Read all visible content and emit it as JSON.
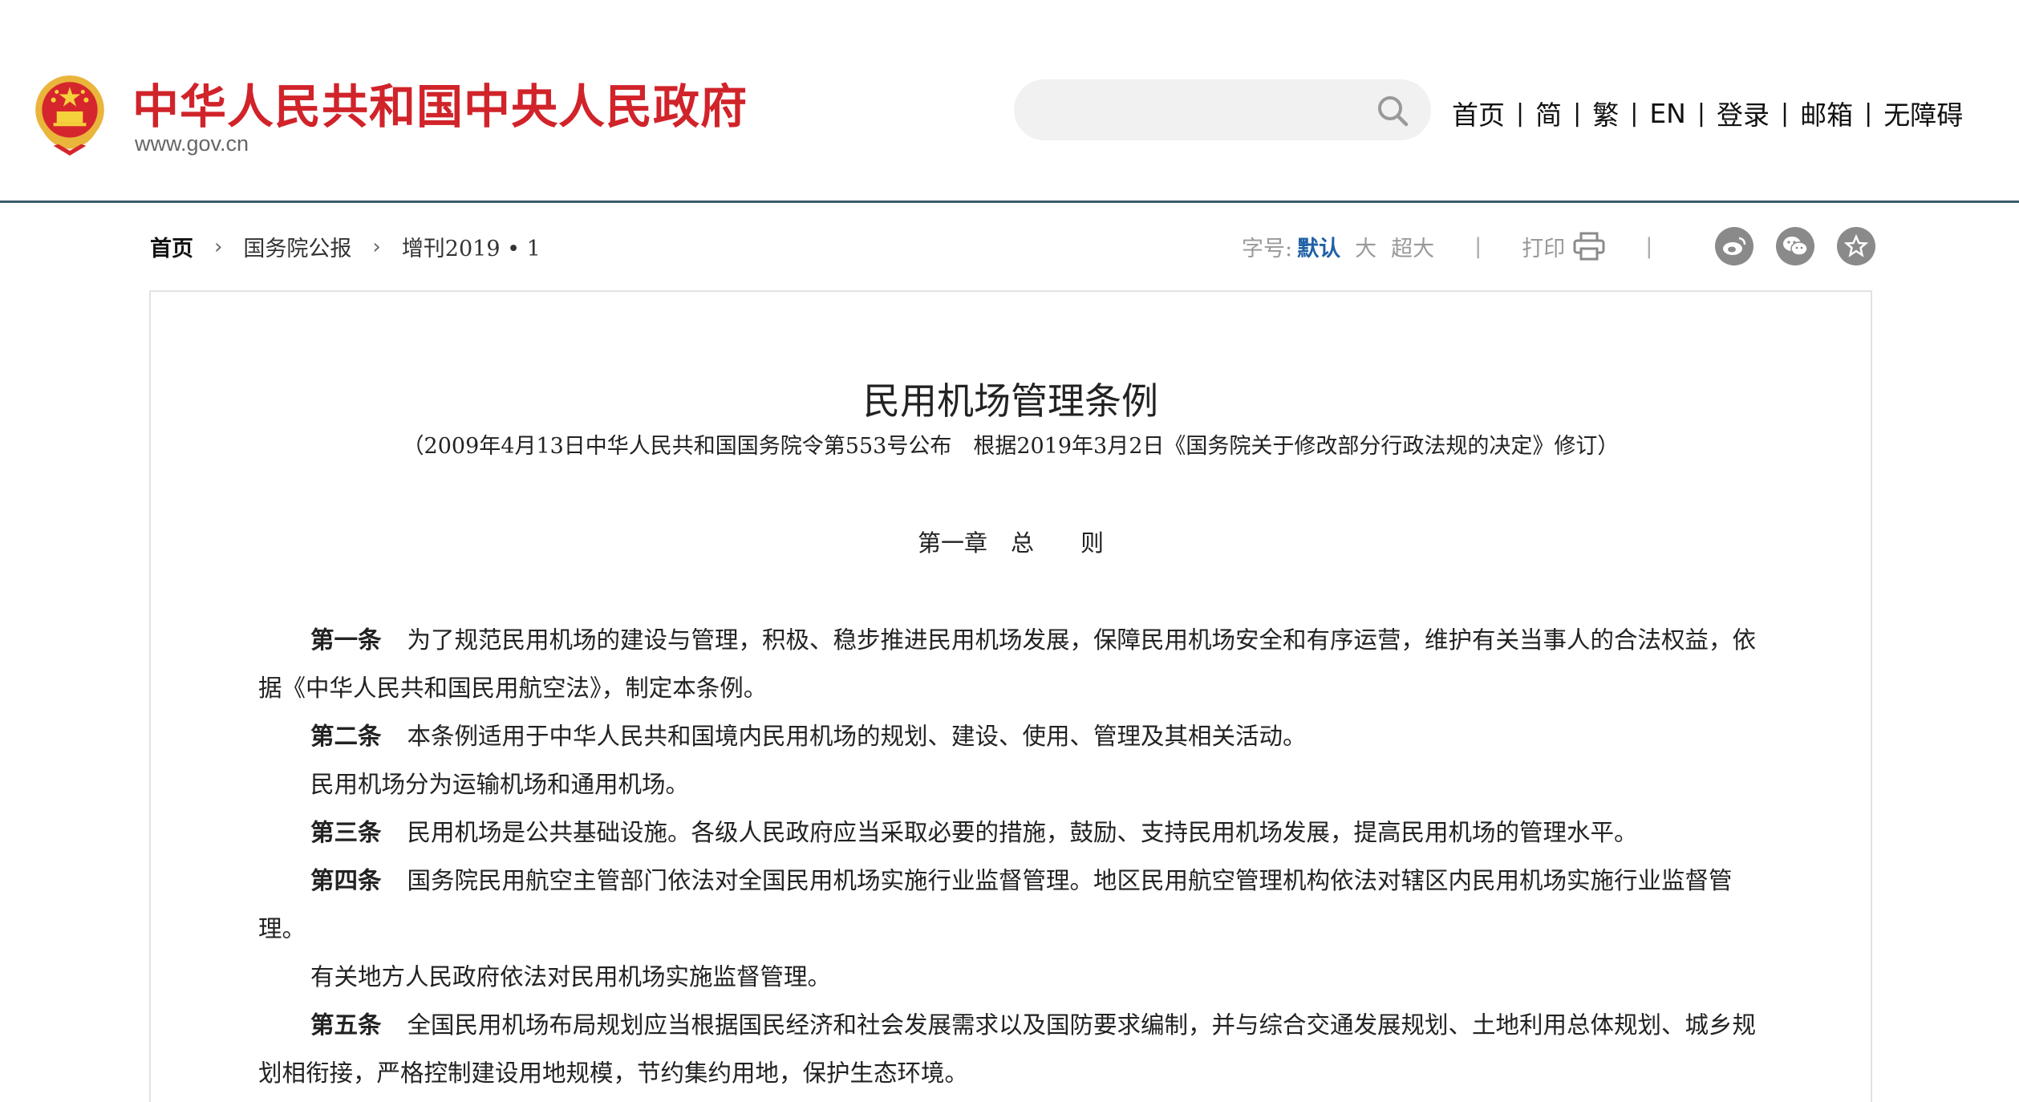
{
  "header": {
    "site_title": "中华人民共和国中央人民政府",
    "site_url": "www.gov.cn",
    "search": {
      "value": "",
      "placeholder": ""
    },
    "nav": [
      "首页",
      "简",
      "繁",
      "EN",
      "登录",
      "邮箱",
      "无障碍"
    ]
  },
  "breadcrumb": [
    "首页",
    "国务院公报",
    "增刊2019 • 1"
  ],
  "tools": {
    "font_size_label": "字号:",
    "font_sizes": [
      "默认",
      "大",
      "超大"
    ],
    "print_label": "打印",
    "share_icons": [
      "weibo-icon",
      "wechat-icon",
      "favorite-icon"
    ]
  },
  "colors": {
    "brand_red": "#d1232a",
    "accent_blue": "#1f5fa6",
    "header_rule": "#3c5a6e"
  },
  "article": {
    "title": "民用机场管理条例",
    "subtitle": "（2009年4月13日中华人民共和国国务院令第553号公布　根据2019年3月2日《国务院关于修改部分行政法规的决定》修订）",
    "chapter": "第一章　总　　则",
    "paragraphs": [
      {
        "article_no": "第一条",
        "text": "为了规范民用机场的建设与管理，积极、稳步推进民用机场发展，保障民用机场安全和有序运营，维护有关当事人的合法权益，依据《中华人民共和国民用航空法》，制定本条例。"
      },
      {
        "article_no": "第二条",
        "text": "本条例适用于中华人民共和国境内民用机场的规划、建设、使用、管理及其相关活动。"
      },
      {
        "article_no": "",
        "text": "民用机场分为运输机场和通用机场。"
      },
      {
        "article_no": "第三条",
        "text": "民用机场是公共基础设施。各级人民政府应当采取必要的措施，鼓励、支持民用机场发展，提高民用机场的管理水平。"
      },
      {
        "article_no": "第四条",
        "text": "国务院民用航空主管部门依法对全国民用机场实施行业监督管理。地区民用航空管理机构依法对辖区内民用机场实施行业监督管理。"
      },
      {
        "article_no": "",
        "text": "有关地方人民政府依法对民用机场实施监督管理。"
      },
      {
        "article_no": "第五条",
        "text": "全国民用机场布局规划应当根据国民经济和社会发展需求以及国防要求编制，并与综合交通发展规划、土地利用总体规划、城乡规划相衔接，严格控制建设用地规模，节约集约用地，保护生态环境。"
      }
    ]
  }
}
